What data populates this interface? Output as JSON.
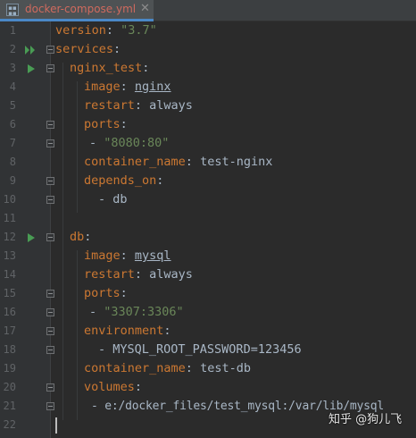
{
  "tab": {
    "title": "docker-compose.yml",
    "close_glyph": "✕",
    "icon": "docker-compose-file-icon",
    "title_color": "#d06a5e"
  },
  "editor": {
    "line_numbers": [
      "1",
      "2",
      "3",
      "4",
      "5",
      "6",
      "7",
      "8",
      "9",
      "10",
      "11",
      "12",
      "13",
      "14",
      "15",
      "16",
      "17",
      "18",
      "19",
      "20",
      "21",
      "22"
    ],
    "colors": {
      "key": "#cc7832",
      "string": "#6a8759",
      "plain": "#a9b7c6",
      "run_icon": "#499c54",
      "background": "#2b2b2b"
    },
    "lines": {
      "l1": {
        "key": "version",
        "sep": ": ",
        "value": "\"3.7\""
      },
      "l2": {
        "key": "services",
        "sep": ":"
      },
      "l3": {
        "key": "nginx_test",
        "sep": ":"
      },
      "l4": {
        "key": "image",
        "sep": ": ",
        "value": "nginx"
      },
      "l5": {
        "key": "restart",
        "sep": ": ",
        "value": "always"
      },
      "l6": {
        "key": "ports",
        "sep": ":"
      },
      "l7": {
        "dash": "- ",
        "value": "\"8080:80\""
      },
      "l8": {
        "key": "container_name",
        "sep": ": ",
        "value": "test-nginx"
      },
      "l9": {
        "key": "depends_on",
        "sep": ":"
      },
      "l10": {
        "dash": "- ",
        "value": "db"
      },
      "l12": {
        "key": "db",
        "sep": ":"
      },
      "l13": {
        "key": "image",
        "sep": ": ",
        "value": "mysql"
      },
      "l14": {
        "key": "restart",
        "sep": ": ",
        "value": "always"
      },
      "l15": {
        "key": "ports",
        "sep": ":"
      },
      "l16": {
        "dash": "- ",
        "value": "\"3307:3306\""
      },
      "l17": {
        "key": "environment",
        "sep": ":"
      },
      "l18": {
        "dash": "- ",
        "value": "MYSQL_ROOT_PASSWORD=123456"
      },
      "l19": {
        "key": "container_name",
        "sep": ": ",
        "value": "test-db"
      },
      "l20": {
        "key": "volumes",
        "sep": ":"
      },
      "l21": {
        "dash": "- ",
        "value": "e:/docker_files/test_mysql:/var/lib/mysql"
      }
    }
  },
  "watermark": {
    "text": "知乎 @狗儿飞"
  }
}
